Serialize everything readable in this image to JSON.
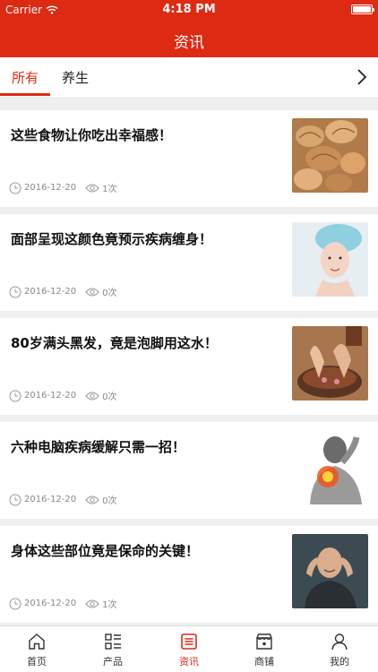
{
  "status_bar": {
    "carrier": "Carrier",
    "time": "4:18 PM"
  },
  "header": {
    "title": "资讯"
  },
  "tabs": [
    {
      "label": "所有",
      "active": true
    },
    {
      "label": "养生",
      "active": false
    }
  ],
  "articles": [
    {
      "title": "这些食物让你吃出幸福感！",
      "date": "2016-12-20",
      "views": "1次",
      "thumbnail": "walnuts"
    },
    {
      "title": "面部呈现这颜色竟预示疾病缠身！",
      "date": "2016-12-20",
      "views": "0次",
      "thumbnail": "woman-towel"
    },
    {
      "title": "80岁满头黑发，竟是泡脚用这水！",
      "date": "2016-12-20",
      "views": "0次",
      "thumbnail": "foot-bath"
    },
    {
      "title": "六种电脑疾病缓解只需一招！",
      "date": "2016-12-20",
      "views": "0次",
      "thumbnail": "neck-pain"
    },
    {
      "title": "身体这些部位竟是保命的关键！",
      "date": "2016-12-20",
      "views": "1次",
      "thumbnail": "man-headache"
    }
  ],
  "tab_bar": [
    {
      "label": "首页",
      "icon": "home-icon",
      "active": false
    },
    {
      "label": "产品",
      "icon": "product-grid-icon",
      "active": false
    },
    {
      "label": "资讯",
      "icon": "news-icon",
      "active": true
    },
    {
      "label": "商铺",
      "icon": "shop-icon",
      "active": false
    },
    {
      "label": "我的",
      "icon": "profile-icon",
      "active": false
    }
  ],
  "colors": {
    "brand": "#dd2a12",
    "background": "#efefef",
    "meta_text": "#888888"
  }
}
